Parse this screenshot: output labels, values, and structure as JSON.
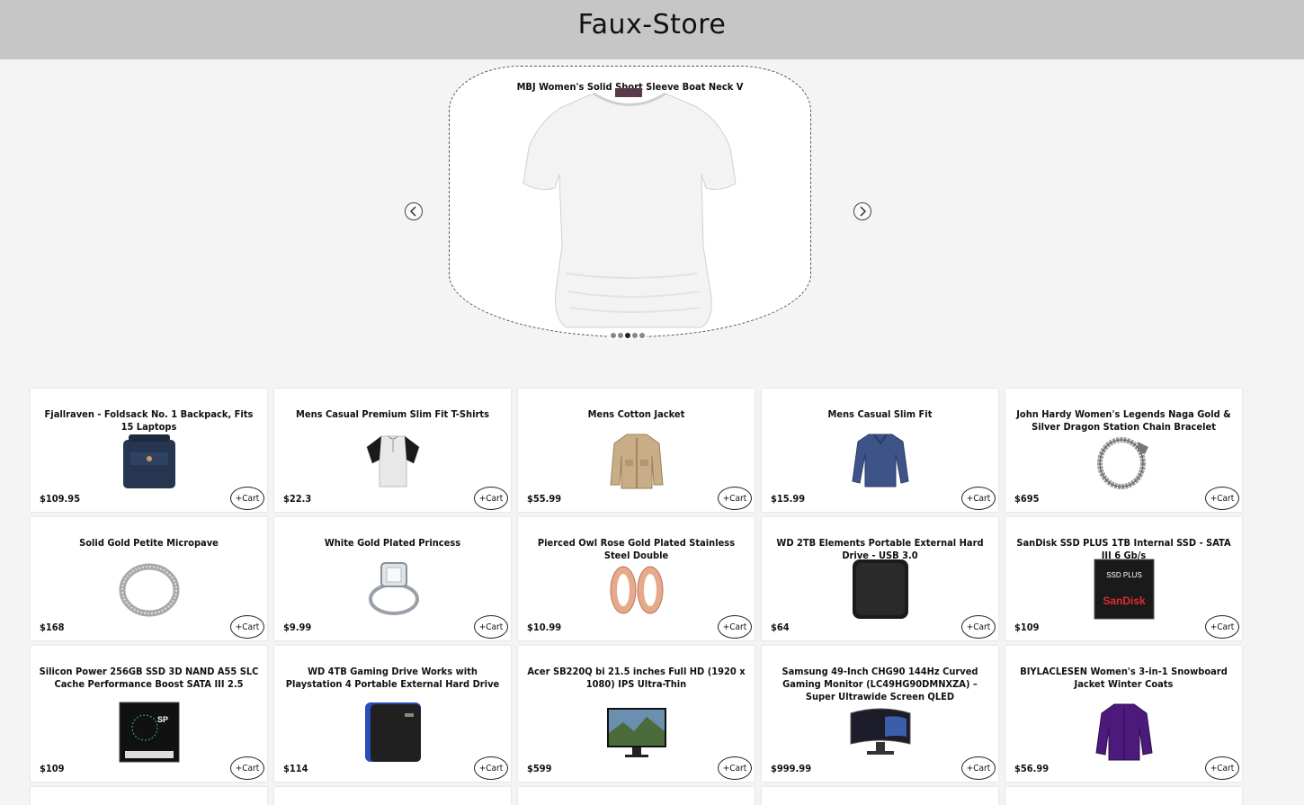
{
  "header": {
    "title": "Faux-Store"
  },
  "carousel": {
    "slide_title": "MBJ Women's Solid Short Sleeve Boat Neck V",
    "image_icon": "white-tshirt-image",
    "slide_count": 5,
    "active_index": 2
  },
  "products": [
    {
      "title": "Fjallraven - Foldsack No. 1 Backpack, Fits 15 Laptops",
      "price": "$109.95",
      "cart": "+Cart",
      "icon": "backpack"
    },
    {
      "title": "Mens Casual Premium Slim Fit T-Shirts",
      "price": "$22.3",
      "cart": "+Cart",
      "icon": "henley-shirt"
    },
    {
      "title": "Mens Cotton Jacket",
      "price": "$55.99",
      "cart": "+Cart",
      "icon": "jacket"
    },
    {
      "title": "Mens Casual Slim Fit",
      "price": "$15.99",
      "cart": "+Cart",
      "icon": "long-sleeve-shirt"
    },
    {
      "title": "John Hardy Women's Legends Naga Gold & Silver Dragon Station Chain Bracelet",
      "price": "$695",
      "cart": "+Cart",
      "icon": "bracelet"
    },
    {
      "title": "Solid Gold Petite Micropave",
      "price": "$168",
      "cart": "+Cart",
      "icon": "ring"
    },
    {
      "title": "White Gold Plated Princess",
      "price": "$9.99",
      "cart": "+Cart",
      "icon": "diamond-ring"
    },
    {
      "title": "Pierced Owl Rose Gold Plated Stainless Steel Double",
      "price": "$10.99",
      "cart": "+Cart",
      "icon": "ear-tunnels"
    },
    {
      "title": "WD 2TB Elements Portable External Hard Drive - USB 3.0",
      "price": "$64",
      "cart": "+Cart",
      "icon": "hard-drive"
    },
    {
      "title": "SanDisk SSD PLUS 1TB Internal SSD - SATA III 6 Gb/s",
      "price": "$109",
      "cart": "+Cart",
      "icon": "ssd-sandisk"
    },
    {
      "title": "Silicon Power 256GB SSD 3D NAND A55 SLC Cache Performance Boost SATA III 2.5",
      "price": "$109",
      "cart": "+Cart",
      "icon": "ssd-sp"
    },
    {
      "title": "WD 4TB Gaming Drive Works with Playstation 4 Portable External Hard Drive",
      "price": "$114",
      "cart": "+Cart",
      "icon": "gaming-drive"
    },
    {
      "title": "Acer SB220Q bi 21.5 inches Full HD (1920 x 1080) IPS Ultra-Thin",
      "price": "$599",
      "cart": "+Cart",
      "icon": "monitor"
    },
    {
      "title": "Samsung 49-Inch CHG90 144Hz Curved Gaming Monitor (LC49HG90DMNXZA) – Super Ultrawide Screen QLED",
      "price": "$999.99",
      "cart": "+Cart",
      "icon": "curved-monitor"
    },
    {
      "title": "BIYLACLESEN Women's 3-in-1 Snowboard Jacket Winter Coats",
      "price": "$56.99",
      "cart": "+Cart",
      "icon": "purple-jacket"
    }
  ],
  "labels": {
    "sandisk_brand": "SanDisk",
    "ssd_plus": "SSD PLUS",
    "sp": "SP"
  }
}
